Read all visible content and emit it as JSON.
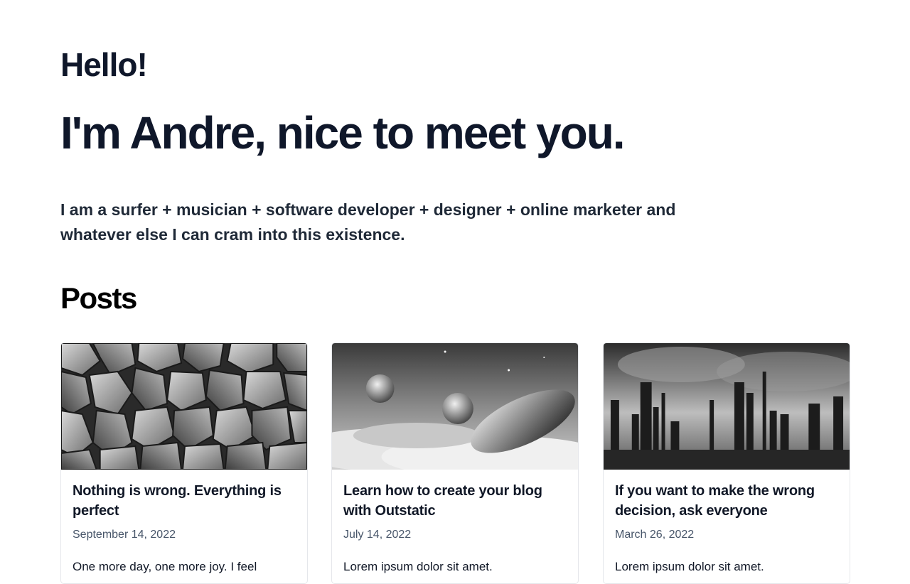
{
  "hero": {
    "greeting": "Hello!",
    "headline": "I'm Andre, nice to meet you.",
    "intro": "I am a surfer + musician + software developer + designer + online marketer and whatever else I can cram into this existence."
  },
  "posts": {
    "title": "Posts",
    "items": [
      {
        "title": "Nothing is wrong. Everything is perfect",
        "date": "September 14, 2022",
        "excerpt": "One more day, one more joy. I feel",
        "image": "gray-stone-blocks-image"
      },
      {
        "title": "Learn how to create your blog with Outstatic",
        "date": "July 14, 2022",
        "excerpt": "Lorem ipsum dolor sit amet.",
        "image": "planets-spaceship-clouds-image"
      },
      {
        "title": "If you want to make the wrong decision, ask everyone",
        "date": "March 26, 2022",
        "excerpt": "Lorem ipsum dolor sit amet.",
        "image": "futuristic-city-skyline-image"
      }
    ]
  }
}
